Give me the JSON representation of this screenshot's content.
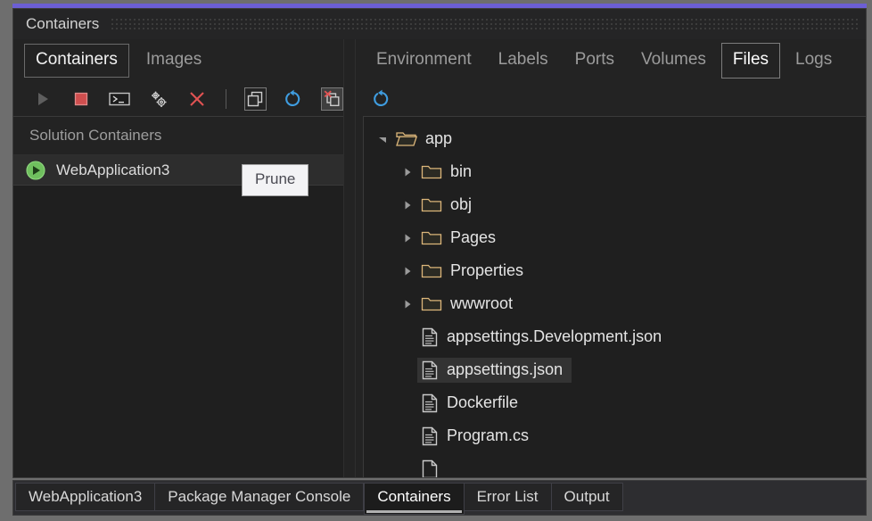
{
  "window": {
    "title": "Containers",
    "accent_color": "#6c5fd4"
  },
  "left_pane": {
    "subtabs": [
      {
        "label": "Containers",
        "active": true
      },
      {
        "label": "Images",
        "active": false
      }
    ],
    "toolbar": [
      {
        "name": "start-button",
        "icon": "play-icon",
        "state": "disabled"
      },
      {
        "name": "stop-button",
        "icon": "stop-square-icon",
        "state": "enabled"
      },
      {
        "name": "open-terminal-button",
        "icon": "terminal-icon",
        "state": "enabled"
      },
      {
        "name": "settings-button",
        "icon": "gears-icon",
        "state": "enabled"
      },
      {
        "name": "remove-button",
        "icon": "close-x-icon",
        "state": "enabled"
      },
      {
        "name": "show-all-containers-button",
        "icon": "stacked-boxes-icon",
        "state": "boxed"
      },
      {
        "name": "refresh-button",
        "icon": "refresh-circular-arrow-icon",
        "state": "enabled"
      },
      {
        "name": "prune-button",
        "icon": "prune-stacked-boxes-x-icon",
        "state": "hovered"
      }
    ],
    "section_header": "Solution Containers",
    "containers": [
      {
        "name": "WebApplication3",
        "status_icon": "running-play-circle-icon",
        "selected": true
      }
    ]
  },
  "tooltip": {
    "text": "Prune",
    "visible": true
  },
  "right_pane": {
    "tabs": [
      {
        "label": "Environment",
        "active": false
      },
      {
        "label": "Labels",
        "active": false
      },
      {
        "label": "Ports",
        "active": false
      },
      {
        "label": "Volumes",
        "active": false
      },
      {
        "label": "Files",
        "active": true
      },
      {
        "label": "Logs",
        "active": false
      }
    ],
    "toolbar": [
      {
        "name": "refresh-files-button",
        "icon": "refresh-circular-arrow-icon"
      }
    ],
    "file_tree": [
      {
        "label": "app",
        "type": "folder",
        "depth": 0,
        "expanded": true,
        "selected": false
      },
      {
        "label": "bin",
        "type": "folder",
        "depth": 1,
        "expanded": false,
        "selected": false
      },
      {
        "label": "obj",
        "type": "folder",
        "depth": 1,
        "expanded": false,
        "selected": false
      },
      {
        "label": "Pages",
        "type": "folder",
        "depth": 1,
        "expanded": false,
        "selected": false
      },
      {
        "label": "Properties",
        "type": "folder",
        "depth": 1,
        "expanded": false,
        "selected": false
      },
      {
        "label": "wwwroot",
        "type": "folder",
        "depth": 1,
        "expanded": false,
        "selected": false
      },
      {
        "label": "appsettings.Development.json",
        "type": "file",
        "depth": 1,
        "selected": false
      },
      {
        "label": "appsettings.json",
        "type": "file",
        "depth": 1,
        "selected": true
      },
      {
        "label": "Dockerfile",
        "type": "file",
        "depth": 1,
        "selected": false
      },
      {
        "label": "Program.cs",
        "type": "file",
        "depth": 1,
        "selected": false
      },
      {
        "label": "",
        "type": "file",
        "depth": 1,
        "selected": false
      }
    ]
  },
  "bottom_tabs": [
    {
      "label": "WebApplication3",
      "active": false
    },
    {
      "label": "Package Manager Console",
      "active": false
    },
    {
      "label": "Containers",
      "active": true
    },
    {
      "label": "Error List",
      "active": false
    },
    {
      "label": "Output",
      "active": false
    }
  ],
  "colors": {
    "accent": "#6c5fd4",
    "folder": "#dcb67a",
    "refresh_blue": "#3f9de0",
    "stop_red": "#d05050",
    "x_red": "#e05252",
    "running_green": "#5ac35a",
    "selected_row": "#333333",
    "tooltip_bg": "#f3f3f5"
  }
}
